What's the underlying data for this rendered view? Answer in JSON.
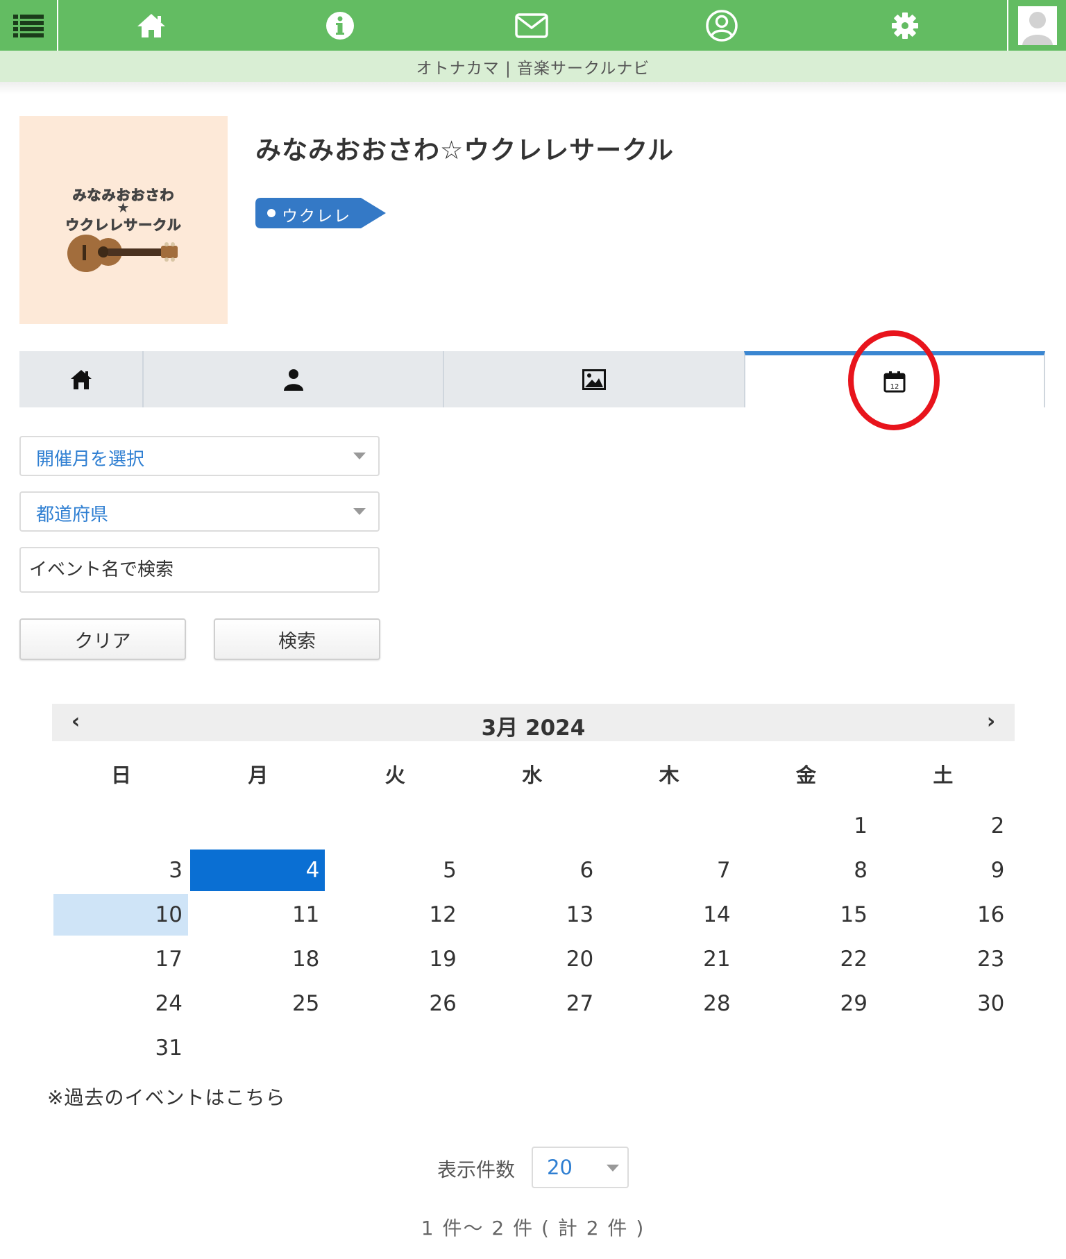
{
  "subbar": {
    "site_title": "オトナカマ | 音楽サークルナビ"
  },
  "topnav": {
    "icons": [
      "menu-list-icon",
      "home-icon",
      "info-icon",
      "mail-icon",
      "user-circle-icon",
      "gear-icon",
      "avatar"
    ],
    "bg_color": "#63bc62"
  },
  "circle": {
    "title": "みなみおおさわ☆ウクレレサークル",
    "logo_line1": "みなみおおさわ",
    "logo_star": "★",
    "logo_line2": "ウクレレサークル",
    "tag": "ウクレレ",
    "tag_color": "#3479c6"
  },
  "tabs": {
    "items": [
      "home-tab-icon",
      "members-tab-icon",
      "gallery-tab-icon",
      "calendar-tab-icon"
    ],
    "active": "calendar",
    "accent": "#3a86d1"
  },
  "filters": {
    "month_select": "開催月を選択",
    "prefecture_select": "都道府県",
    "event_name_placeholder": "イベント名で検索",
    "clear_label": "クリア",
    "search_label": "検索"
  },
  "calendar": {
    "title": "3月 2024",
    "prev": "‹",
    "next": "›",
    "weekdays": [
      "日",
      "月",
      "火",
      "水",
      "木",
      "金",
      "土"
    ],
    "first_weekday_index": 5,
    "days_in_month": 31,
    "today": 4,
    "selected": 10,
    "today_color": "#0a6fd3",
    "selected_color": "#cfe4f7"
  },
  "footer": {
    "past_events": "※過去のイベントはこちら",
    "per_page_label": "表示件数",
    "per_page_value": "20",
    "result_count": "1 件〜 2 件 ( 計 2 件 )"
  }
}
